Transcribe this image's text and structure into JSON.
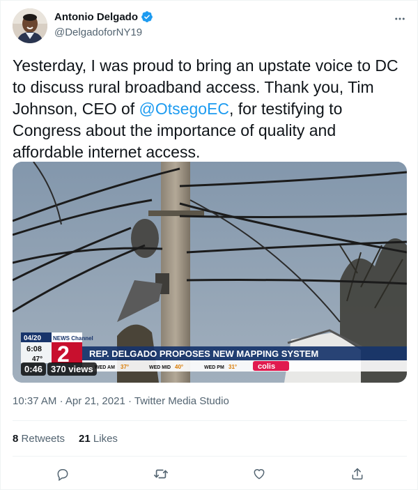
{
  "author": {
    "name": "Antonio Delgado",
    "handle": "@DelgadoforNY19"
  },
  "tweet": {
    "text_before": "Yesterday, I was proud to bring an upstate voice to DC to discuss rural broadband access. Thank you, Tim Johnson, CEO of ",
    "mention": "@OtsegoEC",
    "text_after": ", for testifying to Congress about the importance of quality and affordable internet access."
  },
  "video": {
    "duration": "0:46",
    "views": "370 views",
    "broadcast": {
      "date": "04/20",
      "time": "6:08",
      "temp": "47°",
      "channel_name": "NEWS Channel",
      "channel_number": "2",
      "headline": "REP. DELGADO PROPOSES NEW MAPPING SYSTEM",
      "forecast": [
        {
          "label": "WED AM",
          "temp": "37°"
        },
        {
          "label": "WED MID",
          "temp": "40°"
        },
        {
          "label": "WED PM",
          "temp": "31°"
        }
      ],
      "sponsor": "colis"
    }
  },
  "meta": {
    "time": "10:37 AM",
    "separator": "·",
    "date": "Apr 21, 2021",
    "source": "Twitter Media Studio"
  },
  "stats": {
    "retweets_count": "8",
    "retweets_label": "Retweets",
    "likes_count": "21",
    "likes_label": "Likes"
  },
  "colors": {
    "accent": "#1d9bf0",
    "secondary_text": "#536471",
    "banner_red": "#c8102e",
    "banner_blue": "#17346b"
  }
}
